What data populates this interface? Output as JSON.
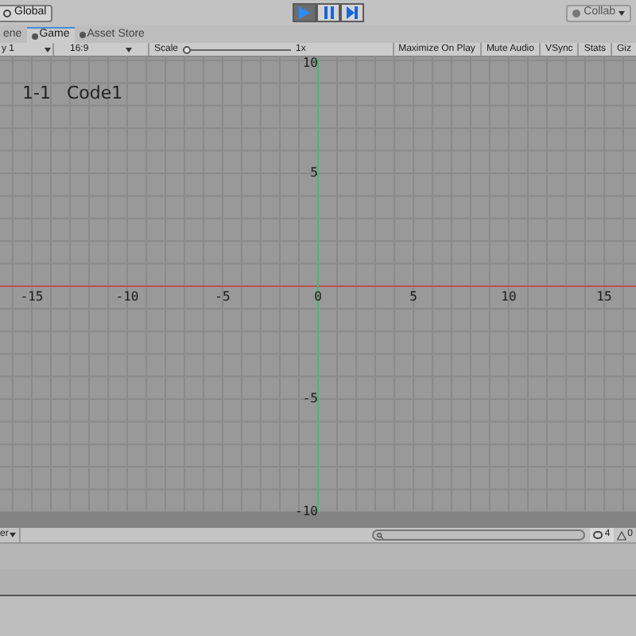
{
  "toolbar": {
    "pivot_button": "Global",
    "play_buttons": [
      {
        "kind": "play",
        "selected": true
      },
      {
        "kind": "pause",
        "selected": false
      },
      {
        "kind": "step",
        "selected": false
      }
    ],
    "collab_button": "Collab"
  },
  "tabs": [
    {
      "label": "ene",
      "selected": false,
      "icon": false
    },
    {
      "label": "Game",
      "selected": true,
      "icon": true
    },
    {
      "label": "Asset Store",
      "selected": false,
      "icon": true
    }
  ],
  "game_toolbar": {
    "display": "y 1",
    "aspect": "16:9",
    "scale_label": "Scale",
    "scale": {
      "level": 0
    },
    "scale_value": "1x",
    "toggles": [
      {
        "label": "Maximize On Play",
        "on": false
      },
      {
        "label": "Mute Audio",
        "on": false
      },
      {
        "label": "VSync",
        "on": false
      },
      {
        "label": "Stats",
        "on": false
      },
      {
        "label": "Giz",
        "on": false
      }
    ]
  },
  "game_view": {
    "overlay": [
      "1-1",
      "Code1"
    ],
    "x_labels": [
      "-15",
      "-10",
      "-5",
      "0",
      "5",
      "10",
      "15"
    ],
    "y_labels": [
      "10",
      "5",
      "-5",
      "-10"
    ]
  },
  "console": {
    "menu": "er",
    "info_count": "4",
    "warning_count": "0"
  }
}
